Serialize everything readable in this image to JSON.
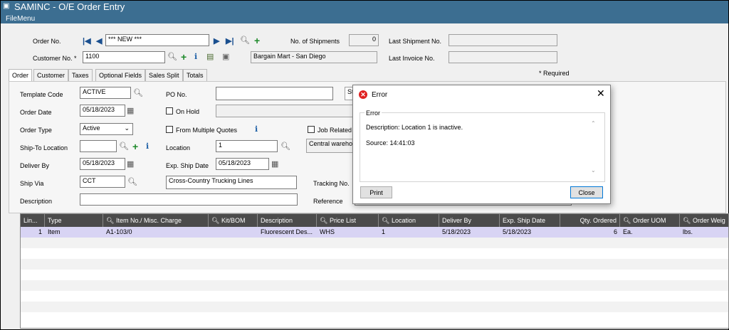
{
  "window": {
    "title": "SAMINC - O/E Order Entry",
    "menu": "FileMenu"
  },
  "header": {
    "order_no_label": "Order No.",
    "order_no_value": "*** NEW ***",
    "customer_no_label": "Customer No. *",
    "customer_no_value": "1100",
    "customer_name": "Bargain Mart - San Diego",
    "shipments_label": "No. of Shipments",
    "shipments_value": "0",
    "last_shipment_label": "Last Shipment No.",
    "last_shipment_value": "",
    "last_invoice_label": "Last Invoice No.",
    "last_invoice_value": "",
    "required_note": "* Required"
  },
  "tabs": [
    {
      "label": "Order"
    },
    {
      "label": "Customer"
    },
    {
      "label": "Taxes"
    },
    {
      "label": "Optional Fields"
    },
    {
      "label": "Sales Split"
    },
    {
      "label": "Totals"
    }
  ],
  "form": {
    "template_code_label": "Template Code",
    "template_code_value": "ACTIVE",
    "order_date_label": "Order Date",
    "order_date_value": "05/18/2023",
    "order_type_label": "Order Type",
    "order_type_value": "Active",
    "ship_to_label": "Ship-To Location",
    "ship_to_value": "",
    "deliver_by_label": "Deliver By",
    "deliver_by_value": "05/18/2023",
    "ship_via_label": "Ship Via",
    "ship_via_value": "CCT",
    "ship_via_desc": "Cross-Country Trucking Lines",
    "description_label": "Description",
    "description_value": "",
    "po_label": "PO No.",
    "po_value": "",
    "po_side_text": "St",
    "on_hold_label": "On Hold",
    "multi_quotes_label": "From Multiple Quotes",
    "job_related_label": "Job Related",
    "location_label": "Location",
    "location_value": "1",
    "location_desc": "Central wareho",
    "exp_ship_label": "Exp. Ship Date",
    "exp_ship_value": "05/18/2023",
    "tracking_label": "Tracking No.",
    "reference_label": "Reference"
  },
  "grid": {
    "columns": [
      "Lin...",
      "Type",
      "Item No./ Misc. Charge",
      "Kit/BOM",
      "Description",
      "Price List",
      "Location",
      "Deliver By",
      "Exp. Ship Date",
      "Qty. Ordered",
      "Order UOM",
      "Order Weig"
    ],
    "rows": [
      [
        "1",
        "Item",
        "A1-103/0",
        "",
        "Fluorescent Des...",
        "WHS",
        "1",
        "5/18/2023",
        "5/18/2023",
        "6",
        "Ea.",
        "lbs."
      ]
    ],
    "empty_rows": 8
  },
  "dialog": {
    "title": "Error",
    "group_label": "Error",
    "message": "Description: Location 1 is inactive.",
    "source": "Source:  14:41:03",
    "print_label": "Print",
    "close_label": "Close"
  },
  "colors": {
    "titlebar": "#3c6e91",
    "grid_header": "#4b4b4b",
    "selected_row": "#d8d4f4",
    "error_icon": "#e02020"
  }
}
